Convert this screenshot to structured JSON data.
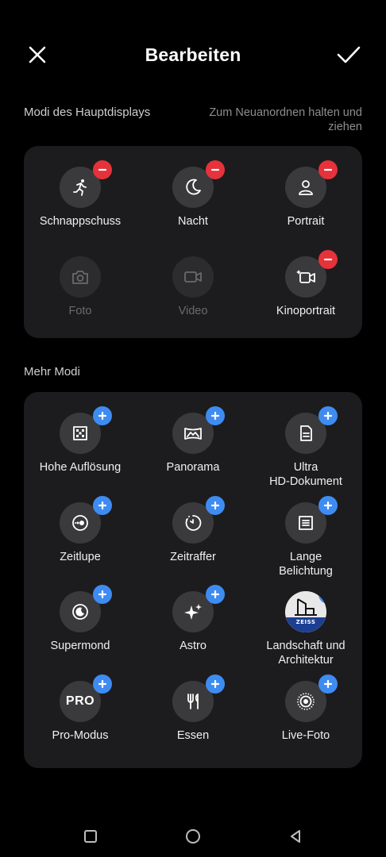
{
  "header": {
    "title": "Bearbeiten",
    "close_icon": "close-icon",
    "confirm_icon": "check-icon"
  },
  "main_modes": {
    "title": "Modi des Hauptdisplays",
    "hint": "Zum Neuanordnen halten und ziehen",
    "items": [
      {
        "label": "Schnappschuss",
        "icon": "running-person-icon",
        "badge": "remove",
        "enabled": true
      },
      {
        "label": "Nacht",
        "icon": "moon-icon",
        "badge": "remove",
        "enabled": true
      },
      {
        "label": "Portrait",
        "icon": "person-icon",
        "badge": "remove",
        "enabled": true
      },
      {
        "label": "Foto",
        "icon": "camera-icon",
        "badge": "none",
        "enabled": false
      },
      {
        "label": "Video",
        "icon": "video-camera-icon",
        "badge": "none",
        "enabled": false
      },
      {
        "label": "Kinoportrait",
        "icon": "cinema-camera-icon",
        "badge": "remove",
        "enabled": true
      }
    ]
  },
  "more_modes": {
    "title": "Mehr Modi",
    "items": [
      {
        "label": "Hohe Auflösung",
        "icon": "high-resolution-icon",
        "badge": "add"
      },
      {
        "label": "Panorama",
        "icon": "panorama-icon",
        "badge": "add"
      },
      {
        "label": "Ultra\nHD-Dokument",
        "icon": "document-icon",
        "badge": "add"
      },
      {
        "label": "Zeitlupe",
        "icon": "slow-motion-icon",
        "badge": "add"
      },
      {
        "label": "Zeitraffer",
        "icon": "timelapse-icon",
        "badge": "add"
      },
      {
        "label": "Lange\nBelichtung",
        "icon": "long-exposure-icon",
        "badge": "add"
      },
      {
        "label": "Supermond",
        "icon": "supermoon-icon",
        "badge": "add"
      },
      {
        "label": "Astro",
        "icon": "sparkle-icon",
        "badge": "add"
      },
      {
        "label": "Landschaft und\nArchitektur",
        "icon": "zeiss-landscape-icon",
        "badge": "add",
        "brand_text": "ZEISS"
      },
      {
        "label": "Pro-Modus",
        "icon": "pro-icon",
        "badge": "add",
        "icon_text": "PRO"
      },
      {
        "label": "Essen",
        "icon": "fork-knife-icon",
        "badge": "add"
      },
      {
        "label": "Live-Foto",
        "icon": "live-photo-icon",
        "badge": "add"
      }
    ]
  },
  "navbar": {
    "recent_icon": "recent-apps-icon",
    "home_icon": "home-icon",
    "back_icon": "back-icon"
  },
  "colors": {
    "background": "#000000",
    "card": "#1c1c1e",
    "icon_circle": "#3a3a3c",
    "remove_badge": "#e5323b",
    "add_badge": "#3e8cf2",
    "zeiss_blue": "#1c3f94"
  }
}
